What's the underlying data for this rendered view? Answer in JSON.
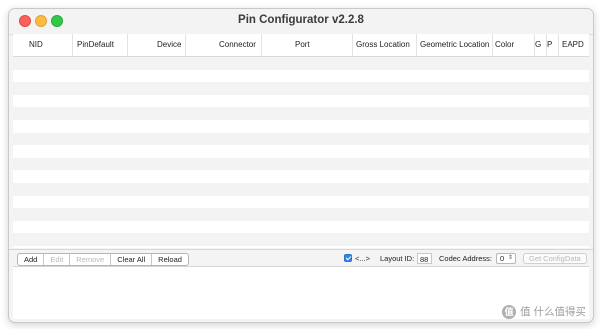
{
  "window": {
    "title": "Pin Configurator v2.2.8"
  },
  "table": {
    "columns": [
      "NID",
      "PinDefault",
      "Device",
      "Connector",
      "Port",
      "Gross Location",
      "Geometric Location",
      "Color",
      "G",
      "P",
      "EAPD"
    ],
    "row_count": 15
  },
  "toolbar": {
    "buttons": [
      {
        "label": "Add",
        "enabled": true
      },
      {
        "label": "Edit",
        "enabled": false
      },
      {
        "label": "Remove",
        "enabled": false
      },
      {
        "label": "Clear All",
        "enabled": true
      },
      {
        "label": "Reload",
        "enabled": true
      }
    ],
    "checkbox_label": "<...>",
    "checkbox_checked": true,
    "layout_id_label": "Layout ID:",
    "layout_id_value": "88",
    "codec_address_label": "Codec Address:",
    "codec_address_value": "0",
    "get_config_label": "Get ConfigData"
  },
  "watermark": {
    "icon": "zhi-icon",
    "text": "值 什么值得买"
  },
  "colors": {
    "close": "#fc605c",
    "minimize": "#fdbc40",
    "zoom": "#34c84a",
    "accent": "#2f84ee"
  }
}
